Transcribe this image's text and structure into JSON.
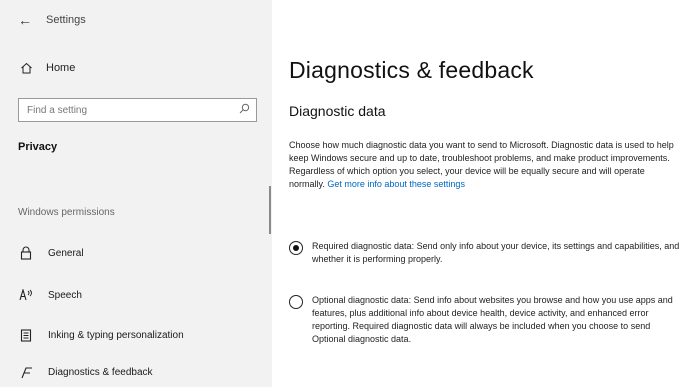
{
  "window": {
    "title": "Settings"
  },
  "sidebar": {
    "home_label": "Home",
    "search_placeholder": "Find a setting",
    "section_label": "Privacy",
    "group_label": "Windows permissions",
    "items": [
      {
        "label": "General",
        "icon": "lock-icon"
      },
      {
        "label": "Speech",
        "icon": "speech-icon"
      },
      {
        "label": "Inking & typing personalization",
        "icon": "inking-icon"
      },
      {
        "label": "Diagnostics & feedback",
        "icon": "diagnostics-icon"
      }
    ]
  },
  "main": {
    "title": "Diagnostics & feedback",
    "section_title": "Diagnostic data",
    "description": "Choose how much diagnostic data you want to send to Microsoft. Diagnostic data is used to help keep Windows secure and up to date, troubleshoot problems, and make product improvements. Regardless of which option you select, your device will be equally secure and will operate normally.",
    "link_text": "Get more info about these settings",
    "options": [
      {
        "label": "Required diagnostic data: Send only info about your device, its settings and capabilities, and whether it is performing properly.",
        "selected": true
      },
      {
        "label": "Optional diagnostic data: Send info about websites you browse and how you use apps and features, plus additional info about device health, device activity, and enhanced error reporting. Required diagnostic data will always be included when you choose to send Optional diagnostic data.",
        "selected": false
      }
    ]
  },
  "colors": {
    "sidebar_bg": "#f2f2f2",
    "content_bg": "#ffffff",
    "link": "#0067c0"
  }
}
